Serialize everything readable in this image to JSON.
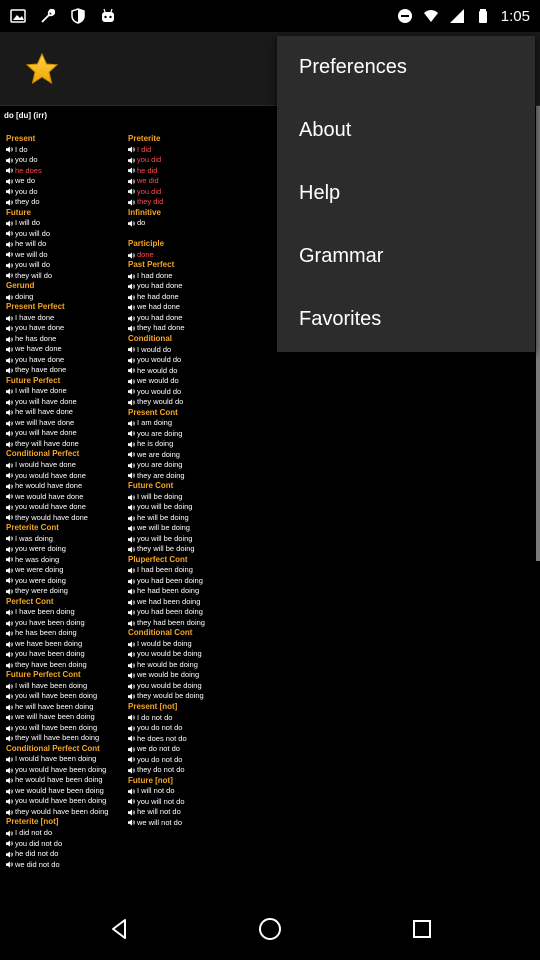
{
  "status_bar": {
    "time": "1:05"
  },
  "verb_title": "do [du] (irr)",
  "menu": {
    "items": [
      {
        "label": "Preferences",
        "name": "menu-item-preferences"
      },
      {
        "label": "About",
        "name": "menu-item-about"
      },
      {
        "label": "Help",
        "name": "menu-item-help"
      },
      {
        "label": "Grammar",
        "name": "menu-item-grammar"
      },
      {
        "label": "Favorites",
        "name": "menu-item-favorites"
      }
    ]
  },
  "columns": [
    {
      "sections": [
        {
          "title": "Present",
          "rows": [
            {
              "t": "I do"
            },
            {
              "t": "you do"
            },
            {
              "t": "he does",
              "hl": true
            },
            {
              "t": "we do"
            },
            {
              "t": "you do"
            },
            {
              "t": "they do"
            }
          ]
        },
        {
          "title": "Future",
          "rows": [
            {
              "t": "I will do"
            },
            {
              "t": "you will do"
            },
            {
              "t": "he will do"
            },
            {
              "t": "we will do"
            },
            {
              "t": "you will do"
            },
            {
              "t": "they will do"
            }
          ]
        },
        {
          "title": "Gerund",
          "rows": [
            {
              "t": " doing"
            }
          ]
        },
        {
          "title": "Present Perfect",
          "rows": [
            {
              "t": "I have done"
            },
            {
              "t": "you have done"
            },
            {
              "t": "he has done"
            },
            {
              "t": "we have done"
            },
            {
              "t": "you have done"
            },
            {
              "t": "they have done"
            }
          ]
        },
        {
          "title": "Future Perfect",
          "rows": [
            {
              "t": "I will have done"
            },
            {
              "t": "you will have done"
            },
            {
              "t": "he will have done"
            },
            {
              "t": "we will have done"
            },
            {
              "t": "you will have done"
            },
            {
              "t": "they will have done"
            }
          ]
        },
        {
          "title": "Conditional Perfect",
          "rows": [
            {
              "t": "I would have done"
            },
            {
              "t": "you would have done"
            },
            {
              "t": "he would have done"
            },
            {
              "t": "we would have done"
            },
            {
              "t": "you would have done"
            },
            {
              "t": "they would have done"
            }
          ]
        },
        {
          "title": "Preterite Cont",
          "rows": [
            {
              "t": "I was doing"
            },
            {
              "t": "you were doing"
            },
            {
              "t": "he was doing"
            },
            {
              "t": "we were doing"
            },
            {
              "t": "you were doing"
            },
            {
              "t": "they were doing"
            }
          ]
        },
        {
          "title": "Perfect Cont",
          "rows": [
            {
              "t": "I have been doing"
            },
            {
              "t": "you have been doing"
            },
            {
              "t": "he has been doing"
            },
            {
              "t": "we have been doing"
            },
            {
              "t": "you have been doing"
            },
            {
              "t": "they have been doing"
            }
          ]
        },
        {
          "title": "Future Perfect Cont",
          "rows": [
            {
              "t": "I will have been doing"
            },
            {
              "t": "you will have been doing"
            },
            {
              "t": "he will have been doing"
            },
            {
              "t": "we will have been doing"
            },
            {
              "t": "you will have been doing"
            },
            {
              "t": "they will have been doing"
            }
          ]
        },
        {
          "title": "Conditional Perfect Cont",
          "rows": [
            {
              "t": "I would have been doing"
            },
            {
              "t": "you would have been doing"
            },
            {
              "t": "he would have been doing"
            },
            {
              "t": "we would have been doing"
            },
            {
              "t": "you would have been doing"
            },
            {
              "t": "they would have been doing"
            }
          ]
        },
        {
          "title": "Preterite [not]",
          "rows": [
            {
              "t": "I did not do"
            },
            {
              "t": "you did not do"
            },
            {
              "t": "he did not do"
            },
            {
              "t": "we did not do"
            }
          ]
        }
      ]
    },
    {
      "sections": [
        {
          "title": "Preterite",
          "rows": [
            {
              "t": "I did",
              "hl": true
            },
            {
              "t": "you did",
              "hl": true
            },
            {
              "t": "he did",
              "hl": true
            },
            {
              "t": "we did",
              "hl": true
            },
            {
              "t": "you did",
              "hl": true
            },
            {
              "t": "they did",
              "hl": true
            }
          ]
        },
        {
          "title": "Infinitive",
          "rows": [
            {
              "t": " do"
            }
          ]
        },
        {
          "title": "",
          "rows": []
        },
        {
          "title": "Participle",
          "rows": [
            {
              "t": " done",
              "hl": true
            }
          ]
        },
        {
          "title": "Past Perfect",
          "rows": [
            {
              "t": "I had done"
            },
            {
              "t": "you had done"
            },
            {
              "t": "he had done"
            },
            {
              "t": "we had done"
            },
            {
              "t": "you had done"
            },
            {
              "t": "they had done"
            }
          ]
        },
        {
          "title": "Conditional",
          "rows": [
            {
              "t": "I would do"
            },
            {
              "t": "you would do"
            },
            {
              "t": "he would do"
            },
            {
              "t": "we would do"
            },
            {
              "t": "you would do"
            },
            {
              "t": "they would do"
            }
          ]
        },
        {
          "title": "Present Cont",
          "rows": [
            {
              "t": "I am doing"
            },
            {
              "t": "you are doing"
            },
            {
              "t": "he is doing"
            },
            {
              "t": "we are doing"
            },
            {
              "t": "you are doing"
            },
            {
              "t": "they are doing"
            }
          ]
        },
        {
          "title": "Future Cont",
          "rows": [
            {
              "t": "I will be doing"
            },
            {
              "t": "you will be doing"
            },
            {
              "t": "he will be doing"
            },
            {
              "t": "we will be doing"
            },
            {
              "t": "you will be doing"
            },
            {
              "t": "they will be doing"
            }
          ]
        },
        {
          "title": "Pluperfect Cont",
          "rows": [
            {
              "t": "I had been doing"
            },
            {
              "t": "you had been doing"
            },
            {
              "t": "he had been doing"
            },
            {
              "t": "we had been doing"
            },
            {
              "t": "you had been doing"
            },
            {
              "t": "they had been doing"
            }
          ]
        },
        {
          "title": "Conditional Cont",
          "rows": [
            {
              "t": "I would be doing"
            },
            {
              "t": "you would be doing"
            },
            {
              "t": "he would be doing"
            },
            {
              "t": "we would be doing"
            },
            {
              "t": "you would be doing"
            },
            {
              "t": "they would be doing"
            }
          ]
        },
        {
          "title": "Present [not]",
          "rows": [
            {
              "t": "I do not do"
            },
            {
              "t": "you do not do"
            },
            {
              "t": "he does not do"
            },
            {
              "t": "we do not do"
            },
            {
              "t": "you do not do"
            },
            {
              "t": "they do not do"
            }
          ]
        },
        {
          "title": "Future [not]",
          "rows": [
            {
              "t": "I will not do"
            },
            {
              "t": "you will not do"
            },
            {
              "t": "he will not do"
            },
            {
              "t": "we will not do"
            }
          ]
        }
      ]
    }
  ],
  "colors": {
    "section_header": "#f5a623",
    "highlight": "#ff4a4a",
    "menu_bg": "#2c2c2c",
    "action_bar": "#1a1a1a"
  },
  "icons": {
    "status_left": [
      "image-icon",
      "wrench-icon",
      "shield-icon",
      "robot-icon"
    ],
    "status_right": [
      "do-not-disturb-icon",
      "wifi-icon",
      "signal-icon",
      "battery-icon"
    ],
    "action_bar": "star-icon",
    "nav": [
      "back-icon",
      "home-icon",
      "recents-icon"
    ]
  }
}
